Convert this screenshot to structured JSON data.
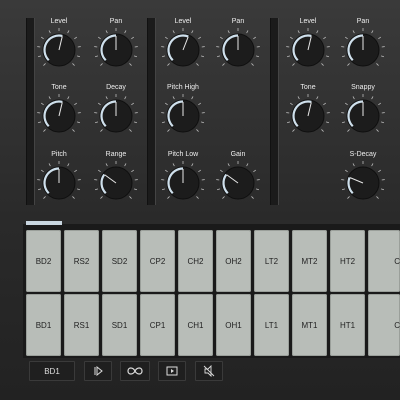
{
  "panels": [
    {
      "knobs": [
        {
          "label": "Level",
          "level": 0.55
        },
        {
          "label": "Pan",
          "level": 0.5
        },
        {
          "label": "Tone",
          "level": 0.55
        },
        {
          "label": "Decay",
          "level": 0.5
        },
        {
          "label": "Pitch",
          "level": 0.5
        },
        {
          "label": "Range",
          "level": 0.3
        }
      ]
    },
    {
      "knobs": [
        {
          "label": "Level",
          "level": 0.58
        },
        {
          "label": "Pan",
          "level": 0.5
        },
        {
          "label": "Pitch High",
          "level": 0.5
        },
        {
          "label": "Pitch Low",
          "level": 0.5
        },
        {
          "label": "Gain",
          "level": 0.3
        }
      ]
    },
    {
      "knobs": [
        {
          "label": "Level",
          "level": 0.55
        },
        {
          "label": "Pan",
          "level": 0.5
        },
        {
          "label": "Tone",
          "level": 0.55
        },
        {
          "label": "Snappy",
          "level": 0.5
        },
        {
          "label": "S-Decay",
          "level": 0.25
        }
      ]
    }
  ],
  "pads": {
    "row1": [
      "BD2",
      "RS2",
      "SD2",
      "CP2",
      "CH2",
      "OH2",
      "LT2",
      "MT2",
      "HT2",
      "C"
    ],
    "row2": [
      "BD1",
      "RS1",
      "SD1",
      "CP1",
      "CH1",
      "OH1",
      "LT1",
      "MT1",
      "HT1",
      "C"
    ]
  },
  "controls": {
    "selected_instrument": "BD1",
    "icons": [
      "skip-start-icon",
      "loop-icon",
      "play-icon",
      "mute-icon"
    ]
  },
  "colors": {
    "accent": "#cfe0ec",
    "pad": "#b8bdb8",
    "background": "#2e2e2e"
  }
}
